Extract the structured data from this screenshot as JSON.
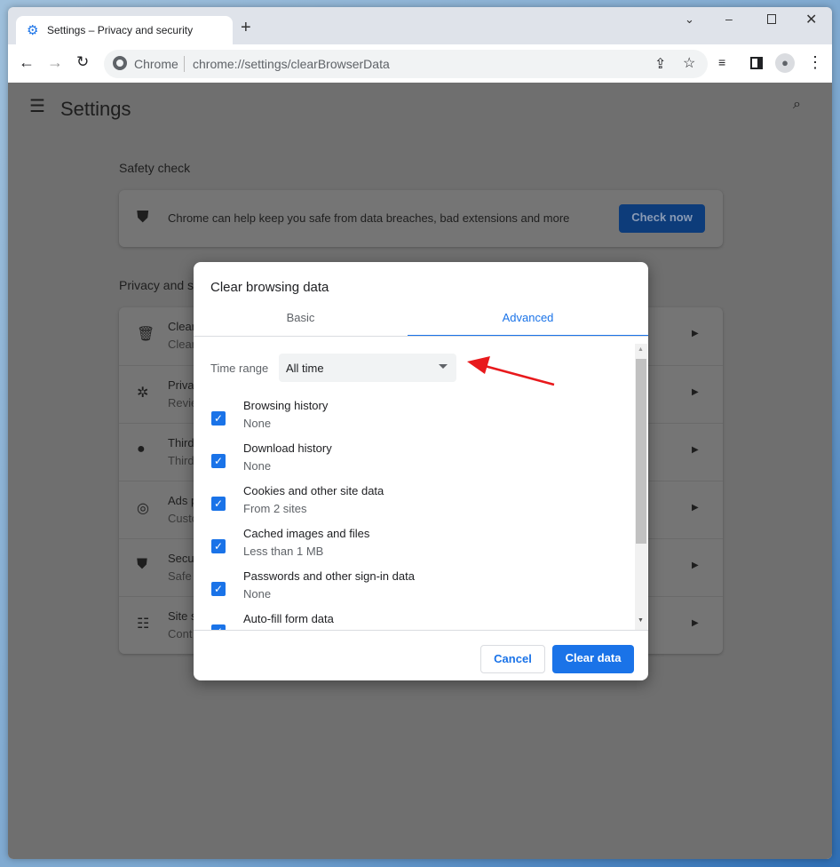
{
  "browser": {
    "tab_title": "Settings – Privacy and security",
    "omnibox_site": "Chrome",
    "url": "chrome://settings/clearBrowserData"
  },
  "settings": {
    "title": "Settings",
    "safety_check": {
      "heading": "Safety check",
      "text": "Chrome can help keep you safe from data breaches, bad extensions and more",
      "button": "Check now"
    },
    "privacy_heading": "Privacy and s",
    "items": [
      {
        "title": "Clear",
        "sub": "Clear",
        "icon": "trash-icon"
      },
      {
        "title": "Priva",
        "sub": "Revie",
        "icon": "privacy-guide-icon"
      },
      {
        "title": "Third",
        "sub": "Third",
        "icon": "cookie-icon"
      },
      {
        "title": "Ads p",
        "sub": "Custo",
        "icon": "ads-icon"
      },
      {
        "title": "Secu",
        "sub": "Safe",
        "icon": "shield-icon"
      },
      {
        "title": "Site s",
        "sub": "Cont",
        "icon": "tune-icon"
      }
    ]
  },
  "dialog": {
    "title": "Clear browsing data",
    "tabs": [
      {
        "label": "Basic"
      },
      {
        "label": "Advanced",
        "active": true
      }
    ],
    "time_range_label": "Time range",
    "time_range_value": "All time",
    "items": [
      {
        "label": "Browsing history",
        "sub": "None",
        "checked": true
      },
      {
        "label": "Download history",
        "sub": "None",
        "checked": true
      },
      {
        "label": "Cookies and other site data",
        "sub": "From 2 sites",
        "checked": true
      },
      {
        "label": "Cached images and files",
        "sub": "Less than 1 MB",
        "checked": true
      },
      {
        "label": "Passwords and other sign-in data",
        "sub": "None",
        "checked": true
      },
      {
        "label": "Auto-fill form data",
        "sub": "",
        "checked": true
      }
    ],
    "cancel": "Cancel",
    "clear": "Clear data"
  },
  "colors": {
    "accent": "#1a73e8",
    "annotation_arrow": "#e8191c"
  }
}
